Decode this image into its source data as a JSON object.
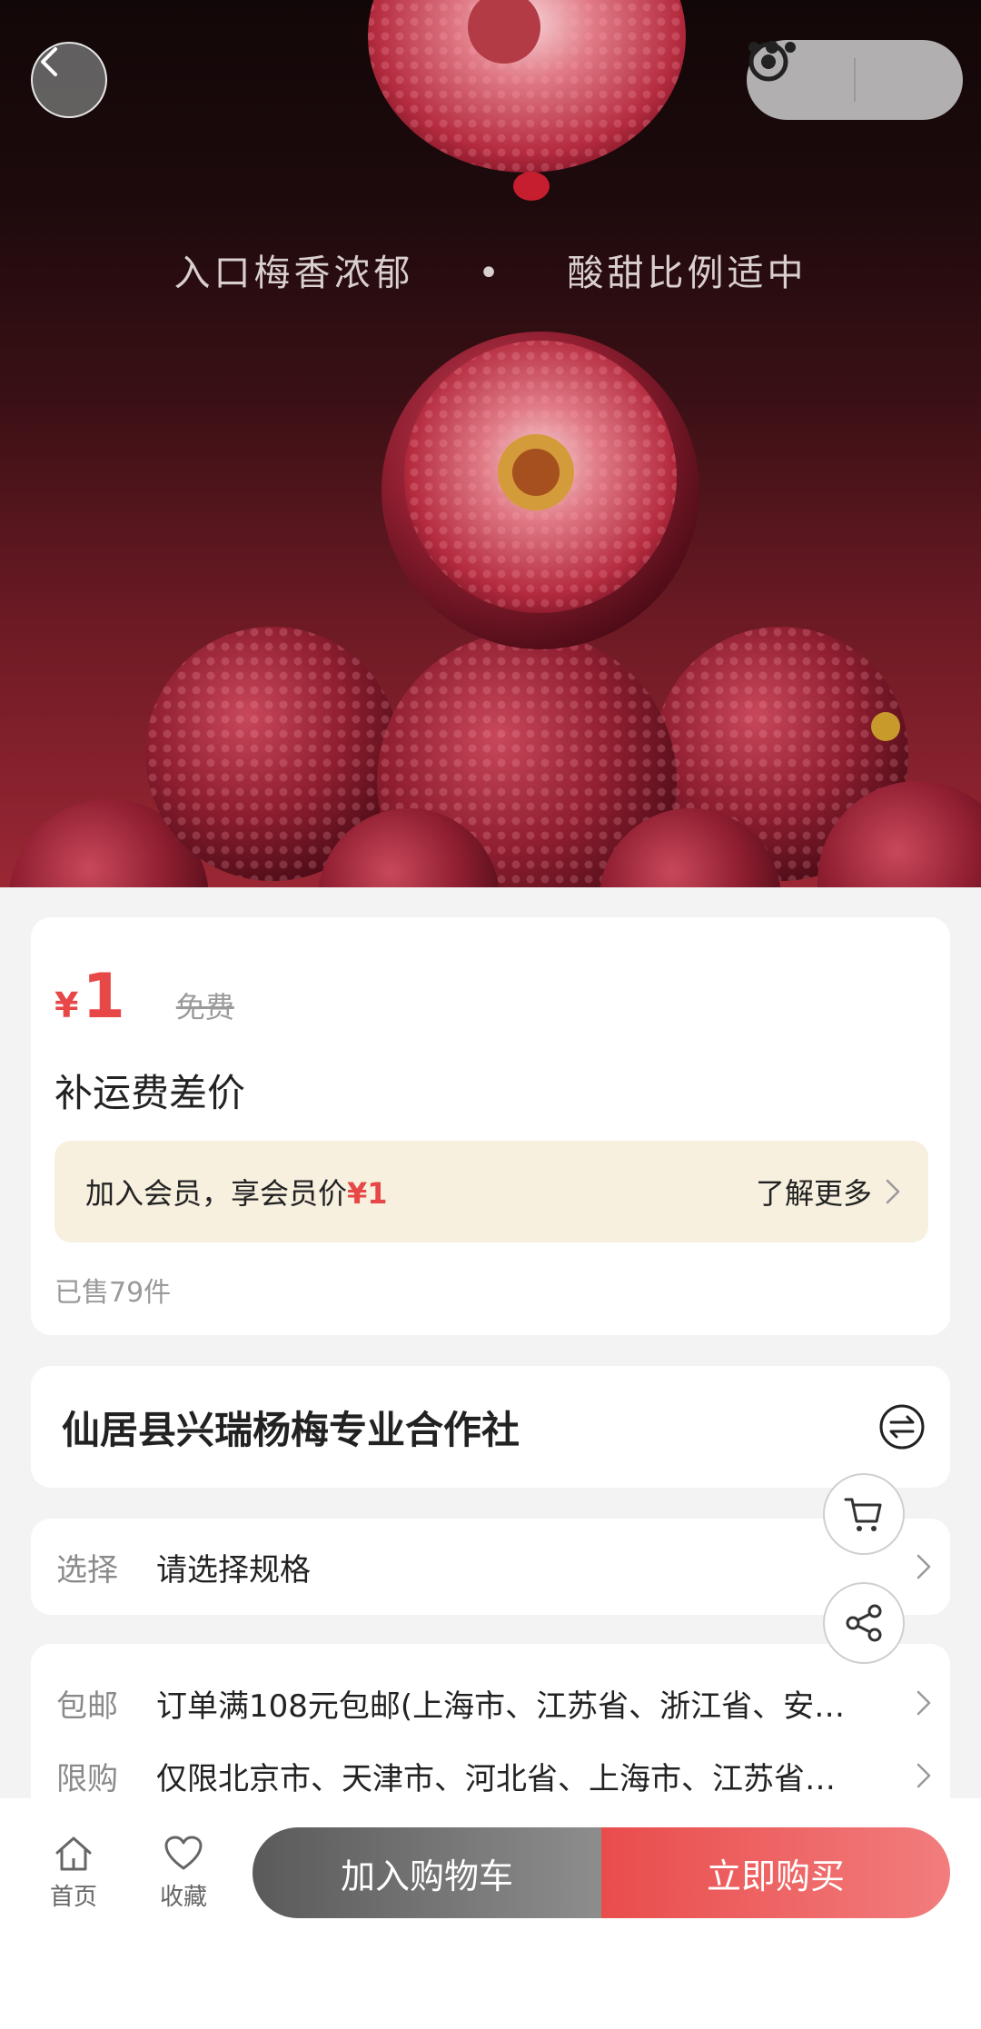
{
  "hero": {
    "tagline_left": "入口梅香浓郁",
    "tagline_dot": "•",
    "tagline_right": "酸甜比例适中"
  },
  "nav_icons": {
    "back": "chevron-left-icon",
    "more": "more-dots-icon",
    "close": "target-circle-icon"
  },
  "price_card": {
    "currency": "¥",
    "price": "1",
    "original_price": "免费",
    "title": "补运费差价",
    "member_text_prefix": "加入会员，享会员价",
    "member_price": "¥1",
    "learn_more": "了解更多",
    "sold": "已售79件"
  },
  "store": {
    "name": "仙居县兴瑞杨梅专业合作社"
  },
  "spec": {
    "label": "选择",
    "value": "请选择规格"
  },
  "shipping": {
    "free_label": "包邮",
    "free_value": "订单满108元包邮(上海市、江苏省、浙江省、安…",
    "limit_label": "限购",
    "limit_value": "仅限北京市、天津市、河北省、上海市、江苏省…"
  },
  "bottom_bar": {
    "home_label": "首页",
    "fav_label": "收藏",
    "add_cart": "加入购物车",
    "buy_now": "立即购买"
  },
  "colors": {
    "accent_red": "#e84747",
    "member_bg": "#f7f0df"
  }
}
